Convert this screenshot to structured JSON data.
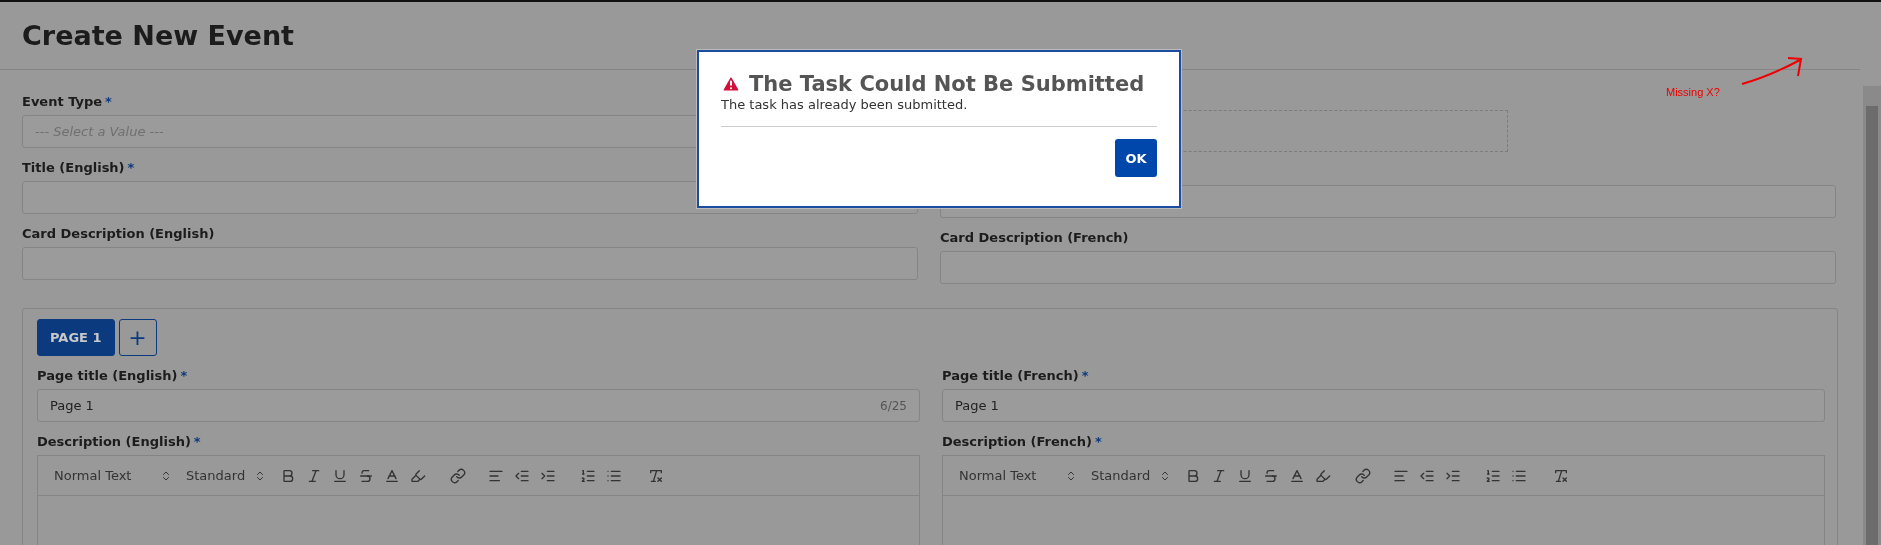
{
  "page": {
    "title": "Create New Event"
  },
  "fields_left": [
    {
      "kind": "select",
      "label": "Event Type",
      "required_mark": "*",
      "placeholder": "--- Select a Value ---"
    },
    {
      "kind": "text",
      "label": "Title (English)",
      "required_mark": "*"
    },
    {
      "kind": "text",
      "label": "Card Description (English)"
    }
  ],
  "fields_right": [
    {
      "kind": "dropzone"
    },
    {
      "kind": "text"
    },
    {
      "kind": "text",
      "label": "Card Description (French)"
    }
  ],
  "page_tabs": [
    {
      "label": "PAGE 1",
      "selected": true
    }
  ],
  "add_page_button": "+",
  "page_columns": [
    {
      "title_label": "Page title (English)",
      "title_mark": "*",
      "description_mark": "*",
      "title_value": "Page 1",
      "counter": "6/25",
      "description_label": "Description (English)",
      "format": "Normal Text",
      "font": "Standard"
    },
    {
      "title_label": "Page title (French)",
      "title_mark": "*",
      "description_mark": "*",
      "title_value": "Page 1",
      "description_label": "Description (French)",
      "format": "Normal Text",
      "font": "Standard"
    }
  ],
  "dialog": {
    "title": "The Task Could Not Be Submitted",
    "message": "The task has already been submitted.",
    "ok_button": "OK"
  },
  "annotation": {
    "text": "Missing X?"
  }
}
